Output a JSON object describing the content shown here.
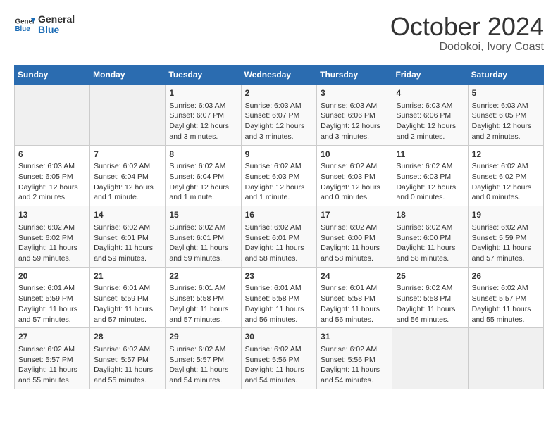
{
  "header": {
    "logo_general": "General",
    "logo_blue": "Blue",
    "month": "October 2024",
    "location": "Dodokoi, Ivory Coast"
  },
  "weekdays": [
    "Sunday",
    "Monday",
    "Tuesday",
    "Wednesday",
    "Thursday",
    "Friday",
    "Saturday"
  ],
  "weeks": [
    [
      {
        "day": "",
        "info": ""
      },
      {
        "day": "",
        "info": ""
      },
      {
        "day": "1",
        "info": "Sunrise: 6:03 AM\nSunset: 6:07 PM\nDaylight: 12 hours and 3 minutes."
      },
      {
        "day": "2",
        "info": "Sunrise: 6:03 AM\nSunset: 6:07 PM\nDaylight: 12 hours and 3 minutes."
      },
      {
        "day": "3",
        "info": "Sunrise: 6:03 AM\nSunset: 6:06 PM\nDaylight: 12 hours and 3 minutes."
      },
      {
        "day": "4",
        "info": "Sunrise: 6:03 AM\nSunset: 6:06 PM\nDaylight: 12 hours and 2 minutes."
      },
      {
        "day": "5",
        "info": "Sunrise: 6:03 AM\nSunset: 6:05 PM\nDaylight: 12 hours and 2 minutes."
      }
    ],
    [
      {
        "day": "6",
        "info": "Sunrise: 6:03 AM\nSunset: 6:05 PM\nDaylight: 12 hours and 2 minutes."
      },
      {
        "day": "7",
        "info": "Sunrise: 6:02 AM\nSunset: 6:04 PM\nDaylight: 12 hours and 1 minute."
      },
      {
        "day": "8",
        "info": "Sunrise: 6:02 AM\nSunset: 6:04 PM\nDaylight: 12 hours and 1 minute."
      },
      {
        "day": "9",
        "info": "Sunrise: 6:02 AM\nSunset: 6:03 PM\nDaylight: 12 hours and 1 minute."
      },
      {
        "day": "10",
        "info": "Sunrise: 6:02 AM\nSunset: 6:03 PM\nDaylight: 12 hours and 0 minutes."
      },
      {
        "day": "11",
        "info": "Sunrise: 6:02 AM\nSunset: 6:03 PM\nDaylight: 12 hours and 0 minutes."
      },
      {
        "day": "12",
        "info": "Sunrise: 6:02 AM\nSunset: 6:02 PM\nDaylight: 12 hours and 0 minutes."
      }
    ],
    [
      {
        "day": "13",
        "info": "Sunrise: 6:02 AM\nSunset: 6:02 PM\nDaylight: 11 hours and 59 minutes."
      },
      {
        "day": "14",
        "info": "Sunrise: 6:02 AM\nSunset: 6:01 PM\nDaylight: 11 hours and 59 minutes."
      },
      {
        "day": "15",
        "info": "Sunrise: 6:02 AM\nSunset: 6:01 PM\nDaylight: 11 hours and 59 minutes."
      },
      {
        "day": "16",
        "info": "Sunrise: 6:02 AM\nSunset: 6:01 PM\nDaylight: 11 hours and 58 minutes."
      },
      {
        "day": "17",
        "info": "Sunrise: 6:02 AM\nSunset: 6:00 PM\nDaylight: 11 hours and 58 minutes."
      },
      {
        "day": "18",
        "info": "Sunrise: 6:02 AM\nSunset: 6:00 PM\nDaylight: 11 hours and 58 minutes."
      },
      {
        "day": "19",
        "info": "Sunrise: 6:02 AM\nSunset: 5:59 PM\nDaylight: 11 hours and 57 minutes."
      }
    ],
    [
      {
        "day": "20",
        "info": "Sunrise: 6:01 AM\nSunset: 5:59 PM\nDaylight: 11 hours and 57 minutes."
      },
      {
        "day": "21",
        "info": "Sunrise: 6:01 AM\nSunset: 5:59 PM\nDaylight: 11 hours and 57 minutes."
      },
      {
        "day": "22",
        "info": "Sunrise: 6:01 AM\nSunset: 5:58 PM\nDaylight: 11 hours and 57 minutes."
      },
      {
        "day": "23",
        "info": "Sunrise: 6:01 AM\nSunset: 5:58 PM\nDaylight: 11 hours and 56 minutes."
      },
      {
        "day": "24",
        "info": "Sunrise: 6:01 AM\nSunset: 5:58 PM\nDaylight: 11 hours and 56 minutes."
      },
      {
        "day": "25",
        "info": "Sunrise: 6:02 AM\nSunset: 5:58 PM\nDaylight: 11 hours and 56 minutes."
      },
      {
        "day": "26",
        "info": "Sunrise: 6:02 AM\nSunset: 5:57 PM\nDaylight: 11 hours and 55 minutes."
      }
    ],
    [
      {
        "day": "27",
        "info": "Sunrise: 6:02 AM\nSunset: 5:57 PM\nDaylight: 11 hours and 55 minutes."
      },
      {
        "day": "28",
        "info": "Sunrise: 6:02 AM\nSunset: 5:57 PM\nDaylight: 11 hours and 55 minutes."
      },
      {
        "day": "29",
        "info": "Sunrise: 6:02 AM\nSunset: 5:57 PM\nDaylight: 11 hours and 54 minutes."
      },
      {
        "day": "30",
        "info": "Sunrise: 6:02 AM\nSunset: 5:56 PM\nDaylight: 11 hours and 54 minutes."
      },
      {
        "day": "31",
        "info": "Sunrise: 6:02 AM\nSunset: 5:56 PM\nDaylight: 11 hours and 54 minutes."
      },
      {
        "day": "",
        "info": ""
      },
      {
        "day": "",
        "info": ""
      }
    ]
  ]
}
